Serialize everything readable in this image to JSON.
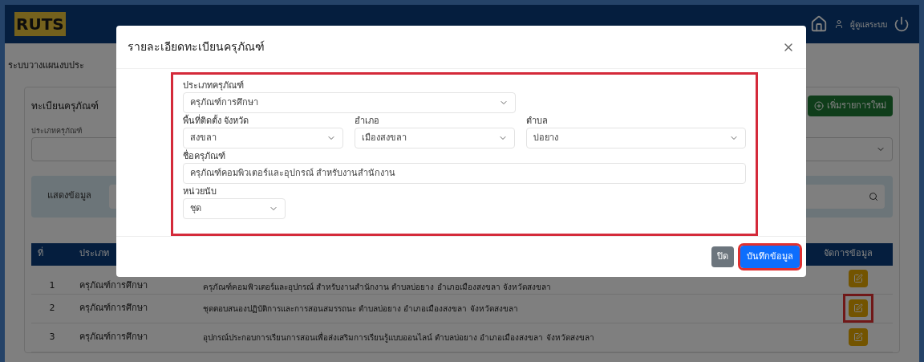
{
  "header": {
    "logo": "RUTS",
    "user": "ผู้ดูแลระบบ"
  },
  "page": {
    "title": "ระบบวางแผนงบประ",
    "card_title": "ทะเบียนครุภัณฑ์",
    "add_button": "เพิ่มรายการใหม่",
    "filter_label": "ประเภทครุภัณฑ์",
    "show_button": "แสดงข้อมูล"
  },
  "table": {
    "columns": [
      "ที่",
      "ประเภท",
      "จัดการข้อมูล"
    ],
    "rows": [
      {
        "no": "1",
        "type": "ครุภัณฑ์การศึกษา",
        "detail": "ครุภัณฑ์คอมพิวเตอร์และอุปกรณ์ สำหรับงานสำนักงาน ตำบลบ่อยาง อำเภอเมืองสงขลา จังหวัดสงขลา",
        "highlighted": false
      },
      {
        "no": "2",
        "type": "ครุภัณฑ์การศึกษา",
        "detail": "ชุดตอบสนองปฏิบัติการและการสอนสมรรถนะ ตำบลบ่อยาง อำเภอเมืองสงขลา จังหวัดสงขลา",
        "highlighted": true
      },
      {
        "no": "3",
        "type": "ครุภัณฑ์การศึกษา",
        "detail": "อุปกรณ์ประกอบการเรียนการสอนเพื่อส่งเสริมการเรียนรู้แบบออนไลน์ ตำบลบ่อยาง อำเภอเมืองสงขลา จังหวัดสงขลา",
        "highlighted": false
      }
    ]
  },
  "modal": {
    "title": "รายละเอียดทะเบียนครุภัณฑ์",
    "form_highlighted": true,
    "fields": [
      {
        "label": "ประเภทครุภัณฑ์",
        "value": "ครุภัณฑ์การศึกษา",
        "kind": "select"
      },
      {
        "label": "พื้นที่ติดตั้ง จังหวัด",
        "value": "สงขลา",
        "kind": "select"
      },
      {
        "label": "อำเภอ",
        "value": "เมืองสงขลา",
        "kind": "select"
      },
      {
        "label": "ตำบล",
        "value": "บ่อยาง",
        "kind": "select"
      },
      {
        "label": "ชื่อครุภัณฑ์",
        "value": "ครุภัณฑ์คอมพิวเตอร์และอุปกรณ์ สำหรับงานสำนักงาน",
        "kind": "text"
      },
      {
        "label": "หน่วยนับ",
        "value": "ชุด",
        "kind": "select"
      }
    ],
    "close_button": "ปิด",
    "save_button": "บันทึกข้อมูล",
    "save_highlighted": true
  }
}
